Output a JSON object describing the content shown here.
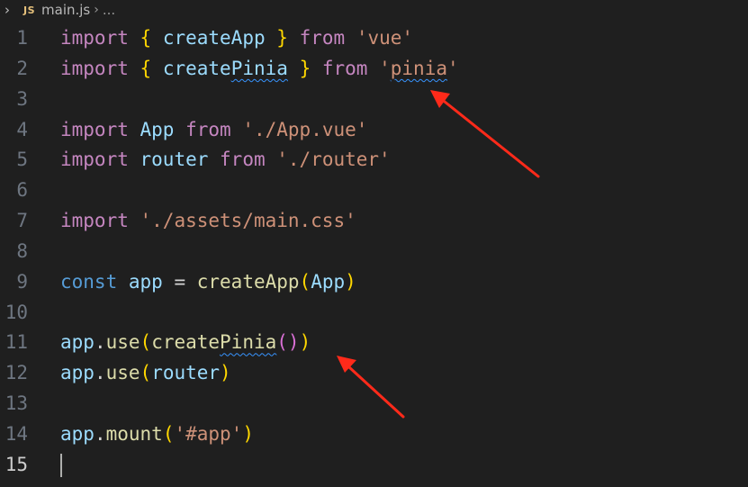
{
  "breadcrumb": {
    "chevron": "›",
    "language_badge": "JS",
    "file_name": "main.js",
    "separator": "›",
    "ellipsis": "..."
  },
  "colors": {
    "background": "#1f1f1f",
    "keyword": "#c586c0",
    "storage": "#569cd6",
    "variable": "#9cdcfe",
    "function": "#dcdcaa",
    "string": "#ce9178",
    "bracket_level1": "#ffd700",
    "bracket_level2": "#da70d6",
    "squiggle": "#3794ff",
    "annotation_arrow": "#ff2a1a"
  },
  "editor": {
    "active_line": 15,
    "lines": [
      {
        "n": "1",
        "tokens": [
          {
            "t": "import",
            "c": "kw"
          },
          {
            "t": " ",
            "c": "op"
          },
          {
            "t": "{",
            "c": "br1"
          },
          {
            "t": " ",
            "c": "op"
          },
          {
            "t": "createApp",
            "c": "id"
          },
          {
            "t": " ",
            "c": "op"
          },
          {
            "t": "}",
            "c": "br1"
          },
          {
            "t": " ",
            "c": "op"
          },
          {
            "t": "from",
            "c": "kw"
          },
          {
            "t": " ",
            "c": "op"
          },
          {
            "t": "'vue'",
            "c": "str"
          }
        ]
      },
      {
        "n": "2",
        "tokens": [
          {
            "t": "import",
            "c": "kw"
          },
          {
            "t": " ",
            "c": "op"
          },
          {
            "t": "{",
            "c": "br1"
          },
          {
            "t": " ",
            "c": "op"
          },
          {
            "t": "create",
            "c": "id"
          },
          {
            "t": "Pinia",
            "c": "id squig"
          },
          {
            "t": " ",
            "c": "op"
          },
          {
            "t": "}",
            "c": "br1"
          },
          {
            "t": " ",
            "c": "op"
          },
          {
            "t": "from",
            "c": "kw"
          },
          {
            "t": " ",
            "c": "op"
          },
          {
            "t": "'",
            "c": "str"
          },
          {
            "t": "pinia",
            "c": "str squig"
          },
          {
            "t": "'",
            "c": "str"
          }
        ]
      },
      {
        "n": "3",
        "tokens": []
      },
      {
        "n": "4",
        "tokens": [
          {
            "t": "import",
            "c": "kw"
          },
          {
            "t": " ",
            "c": "op"
          },
          {
            "t": "App",
            "c": "id"
          },
          {
            "t": " ",
            "c": "op"
          },
          {
            "t": "from",
            "c": "kw"
          },
          {
            "t": " ",
            "c": "op"
          },
          {
            "t": "'./App.vue'",
            "c": "str"
          }
        ]
      },
      {
        "n": "5",
        "tokens": [
          {
            "t": "import",
            "c": "kw"
          },
          {
            "t": " ",
            "c": "op"
          },
          {
            "t": "router",
            "c": "id"
          },
          {
            "t": " ",
            "c": "op"
          },
          {
            "t": "from",
            "c": "kw"
          },
          {
            "t": " ",
            "c": "op"
          },
          {
            "t": "'./router'",
            "c": "str"
          }
        ]
      },
      {
        "n": "6",
        "tokens": []
      },
      {
        "n": "7",
        "tokens": [
          {
            "t": "import",
            "c": "kw"
          },
          {
            "t": " ",
            "c": "op"
          },
          {
            "t": "'./assets/main.css'",
            "c": "str"
          }
        ]
      },
      {
        "n": "8",
        "tokens": []
      },
      {
        "n": "9",
        "tokens": [
          {
            "t": "const",
            "c": "kwb"
          },
          {
            "t": " ",
            "c": "op"
          },
          {
            "t": "app",
            "c": "id"
          },
          {
            "t": " = ",
            "c": "op"
          },
          {
            "t": "createApp",
            "c": "fn"
          },
          {
            "t": "(",
            "c": "br1"
          },
          {
            "t": "App",
            "c": "id"
          },
          {
            "t": ")",
            "c": "br1"
          }
        ]
      },
      {
        "n": "10",
        "tokens": []
      },
      {
        "n": "11",
        "tokens": [
          {
            "t": "app",
            "c": "id"
          },
          {
            "t": ".",
            "c": "op"
          },
          {
            "t": "use",
            "c": "fn"
          },
          {
            "t": "(",
            "c": "br1"
          },
          {
            "t": "create",
            "c": "fn"
          },
          {
            "t": "Pinia",
            "c": "fn squig"
          },
          {
            "t": "()",
            "c": "br2"
          },
          {
            "t": ")",
            "c": "br1"
          }
        ]
      },
      {
        "n": "12",
        "tokens": [
          {
            "t": "app",
            "c": "id"
          },
          {
            "t": ".",
            "c": "op"
          },
          {
            "t": "use",
            "c": "fn"
          },
          {
            "t": "(",
            "c": "br1"
          },
          {
            "t": "router",
            "c": "id"
          },
          {
            "t": ")",
            "c": "br1"
          }
        ]
      },
      {
        "n": "13",
        "tokens": []
      },
      {
        "n": "14",
        "tokens": [
          {
            "t": "app",
            "c": "id"
          },
          {
            "t": ".",
            "c": "op"
          },
          {
            "t": "mount",
            "c": "fn"
          },
          {
            "t": "(",
            "c": "br1"
          },
          {
            "t": "'#app'",
            "c": "str"
          },
          {
            "t": ")",
            "c": "br1"
          }
        ]
      },
      {
        "n": "15",
        "tokens": []
      }
    ]
  }
}
